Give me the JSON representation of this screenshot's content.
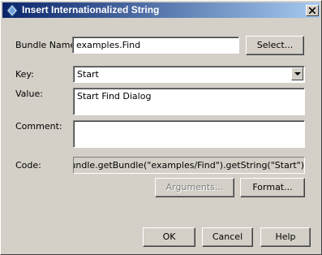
{
  "window": {
    "title": "Insert Internationalized String",
    "title_icon": "java-bean-icon",
    "close_icon": "close-icon"
  },
  "form": {
    "bundle_name_label": "Bundle Name:",
    "bundle_name_value": "examples.Find",
    "select_button": "Select...",
    "key_label": "Key:",
    "key_value": "Start",
    "value_label": "Value:",
    "value_value": "Start Find Dialog",
    "comment_label": "Comment:",
    "comment_value": "",
    "code_label": "Code:",
    "code_value": "urceBundle.getBundle(\"examples/Find\").getString(\"Start\")",
    "arguments_button": "Arguments...",
    "format_button": "Format..."
  },
  "footer": {
    "ok_button": "OK",
    "cancel_button": "Cancel",
    "help_button": "Help"
  },
  "colors": {
    "titlebar_start": "#0a246a",
    "titlebar_end": "#a6caf0",
    "dialog_bg": "#d4d0c8"
  }
}
